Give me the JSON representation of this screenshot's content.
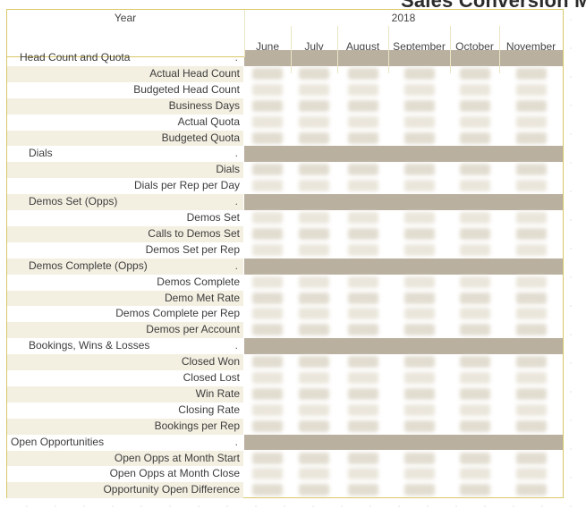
{
  "title_fragment": "Sales Conversion Ma",
  "header": {
    "row_label": "Year",
    "year": "2018",
    "months": [
      "June",
      "July",
      "August",
      "September",
      "October",
      "November"
    ]
  },
  "rows": [
    {
      "label": "Head Count and Quota",
      "group": true,
      "level": 1
    },
    {
      "label": "Actual Head Count"
    },
    {
      "label": "Budgeted Head Count"
    },
    {
      "label": "Business Days"
    },
    {
      "label": "Actual Quota"
    },
    {
      "label": "Budgeted Quota"
    },
    {
      "label": "Dials",
      "group": true,
      "level": 2
    },
    {
      "label": "Dials"
    },
    {
      "label": "Dials per Rep per Day"
    },
    {
      "label": "Demos Set (Opps)",
      "group": true,
      "level": 2
    },
    {
      "label": "Demos Set"
    },
    {
      "label": "Calls to Demos Set"
    },
    {
      "label": "Demos Set per Rep"
    },
    {
      "label": "Demos Complete (Opps)",
      "group": true,
      "level": 2
    },
    {
      "label": "Demos Complete"
    },
    {
      "label": "Demo Met Rate"
    },
    {
      "label": "Demos Complete per Rep"
    },
    {
      "label": "Demos per Account"
    },
    {
      "label": "Bookings, Wins & Losses",
      "group": true,
      "level": 2
    },
    {
      "label": "Closed Won"
    },
    {
      "label": "Closed Lost"
    },
    {
      "label": "Win Rate"
    },
    {
      "label": "Closing Rate"
    },
    {
      "label": "Bookings per Rep"
    },
    {
      "label": "Open Opportunities",
      "group": true,
      "level": 0
    },
    {
      "label": "Open Opps at Month Start"
    },
    {
      "label": "Open Opps at Month Close"
    },
    {
      "label": "Opportunity Open Difference"
    }
  ],
  "group_marker": "."
}
